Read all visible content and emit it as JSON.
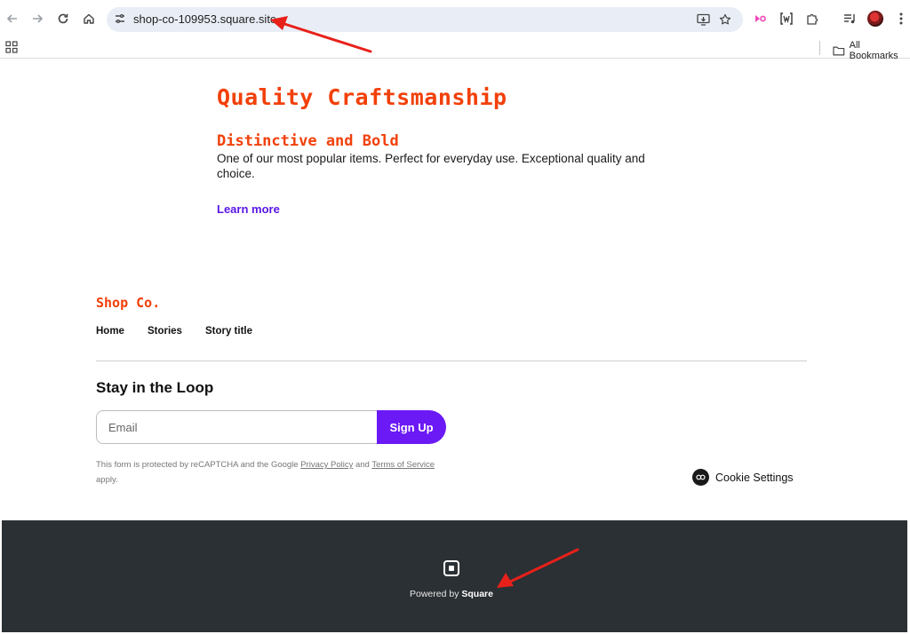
{
  "browser": {
    "url": "shop-co-109953.square.site",
    "bookmarks_label": "All Bookmarks"
  },
  "hero": {
    "title": "Quality Craftsmanship",
    "subtitle": "Distinctive and Bold",
    "body": "One of our most popular items. Perfect for everyday use. Exceptional quality and choice.",
    "link_label": "Learn more"
  },
  "footer_nav": {
    "brand": "Shop Co.",
    "items": [
      {
        "label": "Home"
      },
      {
        "label": "Stories"
      },
      {
        "label": "Story title"
      }
    ]
  },
  "newsletter": {
    "title": "Stay in the Loop",
    "email_placeholder": "Email",
    "email_value": "",
    "signup_label": "Sign Up",
    "legal_prefix": "This form is protected by reCAPTCHA and the Google ",
    "privacy_label": "Privacy Policy",
    "legal_and": " and ",
    "terms_label": "Terms of Service",
    "legal_suffix": " apply."
  },
  "cookie": {
    "label": "Cookie Settings"
  },
  "site_footer": {
    "powered_prefix": "Powered by ",
    "powered_brand": "Square",
    "background": "#2b3034"
  },
  "colors": {
    "accent": "#f2400a",
    "link": "#5a17e6",
    "button": "#6b19f5",
    "annotation": "#e8201a"
  },
  "icons": [
    "back-arrow-icon",
    "forward-arrow-icon",
    "reload-icon",
    "home-icon",
    "site-info-icon",
    "install-app-icon",
    "star-icon",
    "extension-pink-icon",
    "extension-bracket-icon",
    "puzzle-icon",
    "media-icon",
    "avatar",
    "menu-icon",
    "apps-grid-icon",
    "folder-icon",
    "cookie-icon",
    "square-logo-icon"
  ]
}
